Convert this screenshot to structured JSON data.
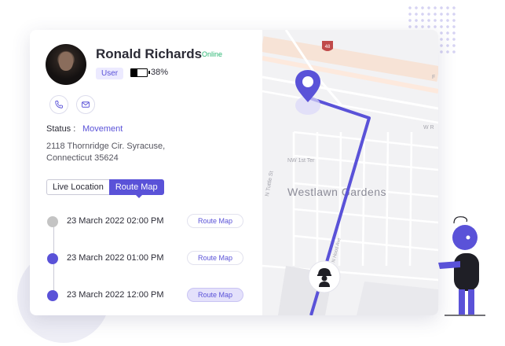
{
  "profile": {
    "name": "Ronald Richards",
    "status_online": "Online",
    "role_badge": "User",
    "battery_level": 0.38,
    "battery_text": "38%"
  },
  "contact": {
    "icons": [
      "phone-icon",
      "mail-icon"
    ]
  },
  "status": {
    "label": "Status :",
    "value": "Movement"
  },
  "address": "2118 Thornridge Cir. Syracuse, Connecticut 35624",
  "tabs": [
    {
      "label": "Live Location",
      "active": false
    },
    {
      "label": "Route Map",
      "active": true
    }
  ],
  "timeline": [
    {
      "datetime": "23 March 2022  02:00 PM",
      "button": "Route Map",
      "dot_color": "#c4c4c4",
      "selected": false
    },
    {
      "datetime": "23 March 2022  01:00 PM",
      "button": "Route Map",
      "dot_color": "#5a52d8",
      "selected": false
    },
    {
      "datetime": "23 March 2022  12:00 PM",
      "button": "Route Map",
      "dot_color": "#5a52d8",
      "selected": true
    }
  ],
  "map": {
    "area_label": "Westlawn Gardens",
    "street_labels": [
      "NW 1st Ter",
      "N Tuttle St",
      "W R",
      "F",
      "N Hood Ave"
    ],
    "highway_shield": "48",
    "route_color": "#5a52d8",
    "marker_icons": [
      "location-pin-icon",
      "worker-icon"
    ]
  },
  "colors": {
    "accent": "#5a52d8",
    "online": "#2bb673"
  }
}
